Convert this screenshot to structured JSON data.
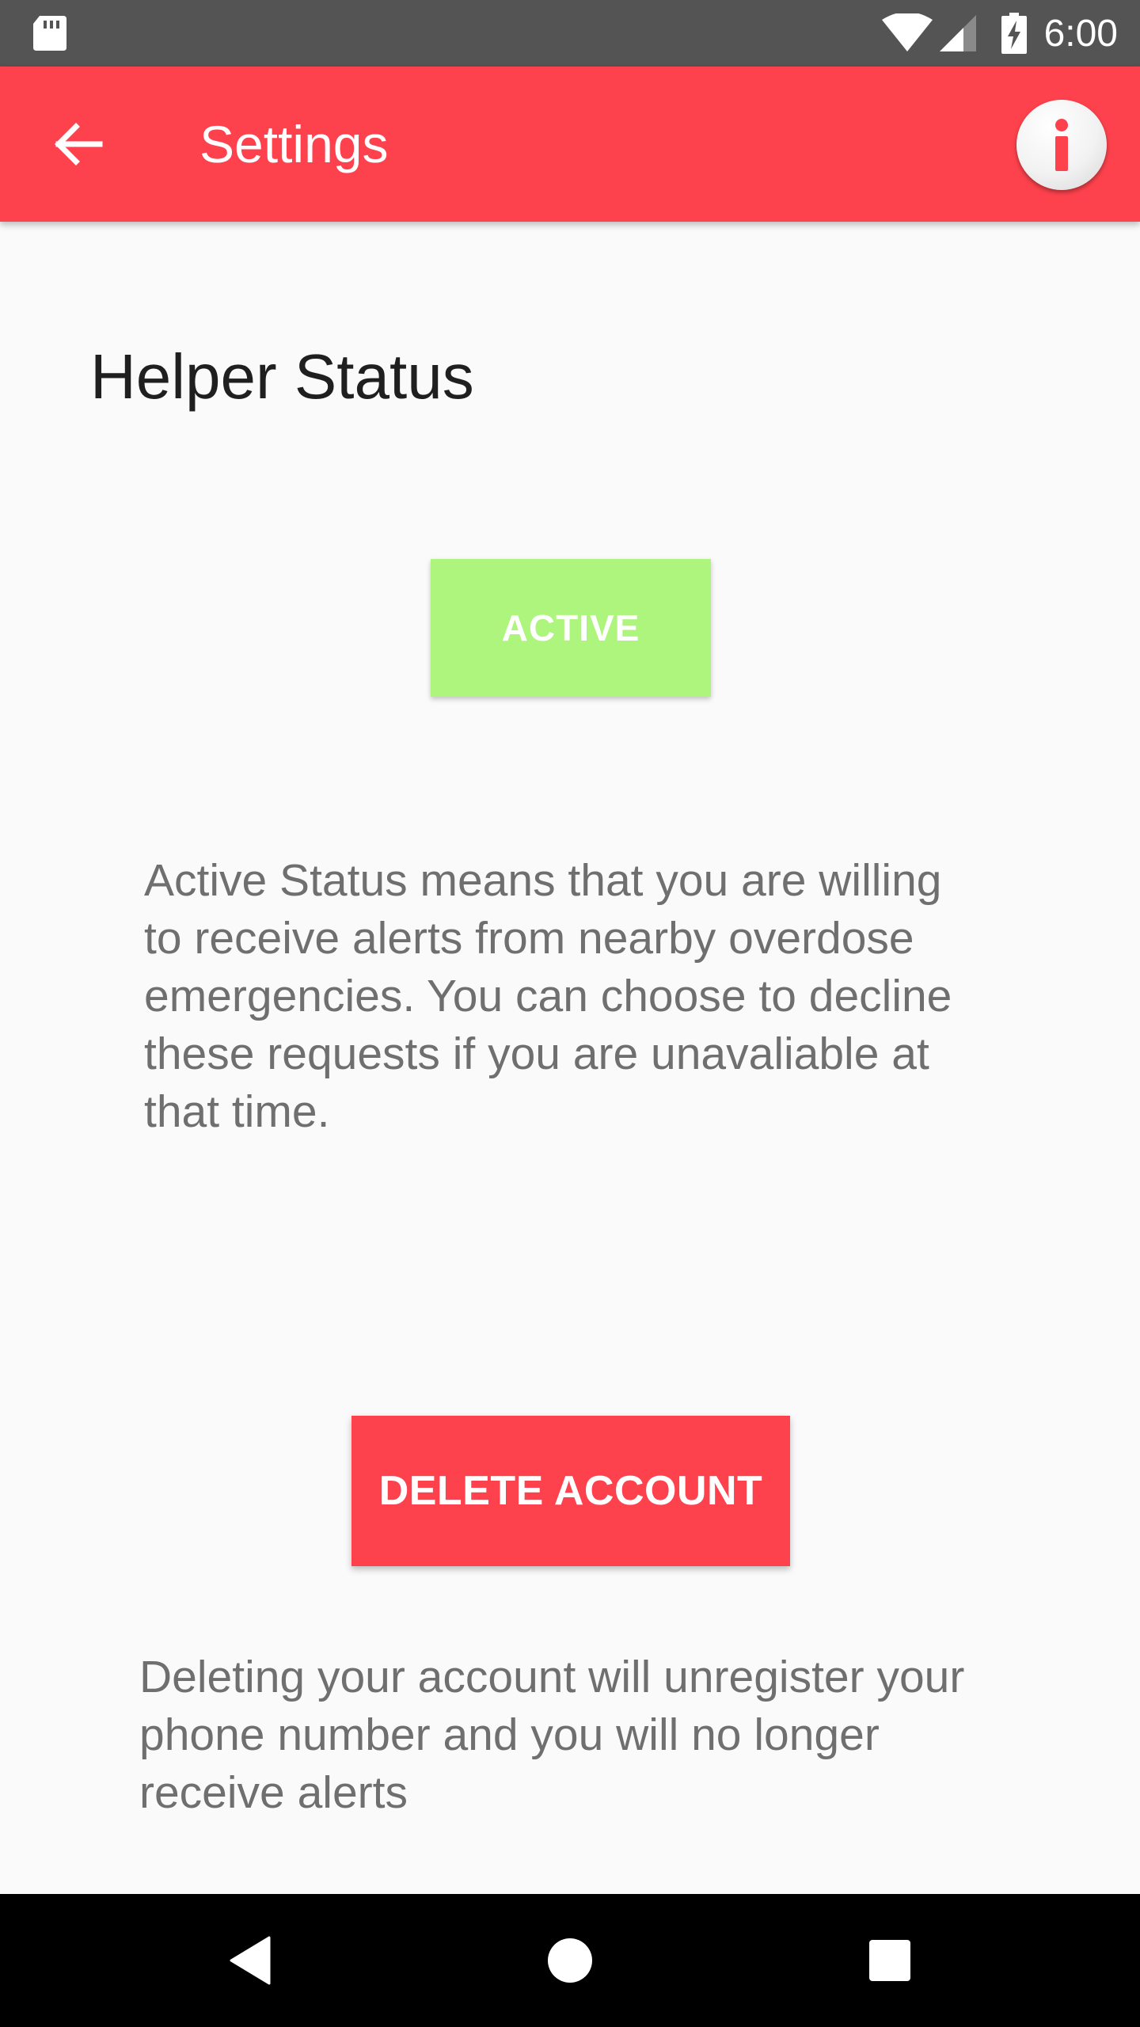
{
  "status_bar": {
    "time": "6:00",
    "icons": [
      "sd-card-icon",
      "wifi-icon",
      "signal-icon",
      "battery-charging-icon"
    ]
  },
  "app_bar": {
    "title": "Settings",
    "back_icon": "arrow-back-icon",
    "info_icon": "info-icon"
  },
  "helper_status": {
    "title": "Helper Status",
    "status_button_label": "ACTIVE",
    "description": "Active Status means that you are willing to receive alerts from nearby overdose emergencies. You can choose to decline these requests if you are unavaliable at that time."
  },
  "account": {
    "delete_button_label": "DELETE ACCOUNT",
    "description": "Deleting your account will unregister your phone number and you will no longer receive alerts"
  },
  "nav_bar": {
    "icons": [
      "nav-back-icon",
      "nav-home-icon",
      "nav-recents-icon"
    ]
  },
  "colors": {
    "primary": "#fe424d",
    "active_green": "#adf57c",
    "status_bar": "#545454",
    "background": "#fafafa",
    "body_text": "#6f6f6f"
  }
}
